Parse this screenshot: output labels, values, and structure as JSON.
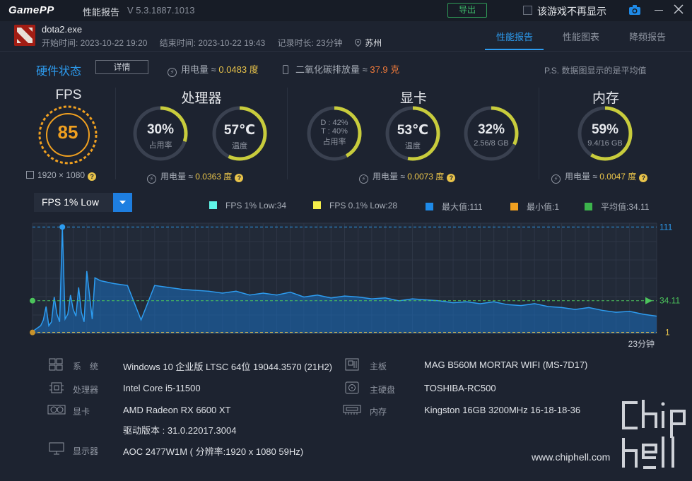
{
  "app": {
    "logo": "GamePP",
    "title": "性能报告",
    "version": "V 5.3.1887.1013",
    "export_label": "导出",
    "hide_label": "该游戏不再显示"
  },
  "session": {
    "exe": "dota2.exe",
    "start": "开始时间: 2023-10-22 19:20",
    "end": "结束时间: 2023-10-22 19:43",
    "duration": "记录时长: 23分钟",
    "city": "苏州"
  },
  "tabs": [
    {
      "label": "性能报告",
      "active": true
    },
    {
      "label": "性能图表",
      "active": false
    },
    {
      "label": "降频报告",
      "active": false
    }
  ],
  "hw_status": {
    "title": "硬件状态",
    "detail_label": "详情",
    "power_prefix": "用电量 ≈ ",
    "power_value": "0.0483 度",
    "co2_prefix": "二氧化碳排放量 ≈ ",
    "co2_value": "37.9 克",
    "note": "P.S. 数据图显示的是平均值"
  },
  "fps": {
    "title": "FPS",
    "value": "85",
    "resolution": "1920 × 1080"
  },
  "cpu": {
    "title": "处理器",
    "usage_value": "30%",
    "usage_label": "占用率",
    "usage_fraction": 0.3,
    "temp_value": "57℃",
    "temp_label": "温度",
    "temp_fraction": 0.57,
    "power_prefix": "用电量 ≈ ",
    "power_value": "0.0363 度"
  },
  "gpu": {
    "title": "显卡",
    "usage_d": "D : 42%",
    "usage_t": "T : 40%",
    "usage_label": "占用率",
    "usage_fraction": 0.42,
    "temp_value": "53℃",
    "temp_label": "温度",
    "temp_fraction": 0.53,
    "vram_value": "32%",
    "vram_sub": "2.56/8 GB",
    "vram_fraction": 0.32,
    "power_prefix": "用电量 ≈ ",
    "power_value": "0.0073 度"
  },
  "mem": {
    "title": "内存",
    "usage_value": "59%",
    "usage_sub": "9.4/16 GB",
    "usage_fraction": 0.59,
    "power_prefix": "用电量 ≈ ",
    "power_value": "0.0047 度"
  },
  "chart_controls": {
    "selected": "FPS 1% Low",
    "legend": [
      {
        "label": "FPS 1% Low:34",
        "color": "#5ff5e8"
      },
      {
        "label": "FPS 0.1% Low:28",
        "color": "#f5ee4a"
      },
      {
        "label": "最大值:111",
        "color": "#1e8ae8"
      },
      {
        "label": "最小值:1",
        "color": "#f0a020"
      },
      {
        "label": "平均值:34.11",
        "color": "#3cb44c"
      }
    ]
  },
  "chart_data": {
    "type": "area",
    "x_unit": "min",
    "xlim": [
      0,
      23
    ],
    "ylim": [
      0,
      115
    ],
    "x_end_label": "23分钟",
    "max_label": "111",
    "avg_label": "34.11",
    "min_label": "1",
    "max": 111,
    "avg": 34.11,
    "min": 1,
    "x": [
      0,
      0.1,
      0.2,
      0.3,
      0.4,
      0.5,
      0.6,
      0.7,
      0.8,
      0.9,
      1.0,
      1.1,
      1.2,
      1.3,
      1.4,
      1.5,
      1.6,
      1.7,
      1.8,
      1.9,
      2.0,
      2.1,
      2.2,
      2.3,
      2.5,
      3.0,
      3.5,
      4.0,
      4.5,
      5.0,
      5.5,
      6.0,
      6.5,
      7.0,
      7.5,
      8.0,
      8.5,
      9.0,
      9.5,
      10.0,
      10.5,
      11.0,
      11.5,
      12.0,
      12.5,
      13.0,
      13.5,
      14.0,
      14.5,
      15.0,
      15.5,
      16.0,
      16.5,
      17.0,
      17.5,
      18.0,
      18.5,
      19.0,
      19.5,
      20.0,
      20.5,
      21.0,
      21.5,
      22.0,
      22.5,
      23.0
    ],
    "values": [
      2,
      4,
      6,
      8,
      14,
      28,
      8,
      12,
      38,
      20,
      12,
      111,
      15,
      20,
      40,
      25,
      18,
      48,
      22,
      12,
      65,
      40,
      15,
      58,
      55,
      52,
      50,
      14,
      50,
      48,
      46,
      45,
      44,
      42,
      44,
      40,
      42,
      40,
      43,
      38,
      40,
      37,
      39,
      38,
      36,
      37,
      34,
      36,
      35,
      34,
      32,
      33,
      31,
      33,
      30,
      29,
      31,
      28,
      27,
      25,
      27,
      24,
      22,
      23,
      20,
      18
    ]
  },
  "hardware": [
    {
      "label": "系　统",
      "value": "Windows 10 企业版 LTSC 64位 19044.3570 (21H2)"
    },
    {
      "label": "处理器",
      "value": "Intel Core i5-11500"
    },
    {
      "label": "显卡",
      "value": "AMD Radeon RX 6600 XT",
      "extra": "驱动版本 : 31.0.22017.3004"
    },
    {
      "label": "显示器",
      "value": "AOC 2477W1M ( 分辨率:1920 x 1080 59Hz)"
    },
    {
      "label": "主板",
      "value": "MAG B560M MORTAR WIFI (MS-7D17)"
    },
    {
      "label": "主硬盘",
      "value": "TOSHIBA-RC500"
    },
    {
      "label": "内存",
      "value": "Kingston 16GB 3200MHz 16-18-18-36"
    }
  ],
  "watermark": {
    "url": "www.chiphell.com",
    "logo_text": "chiphell"
  }
}
